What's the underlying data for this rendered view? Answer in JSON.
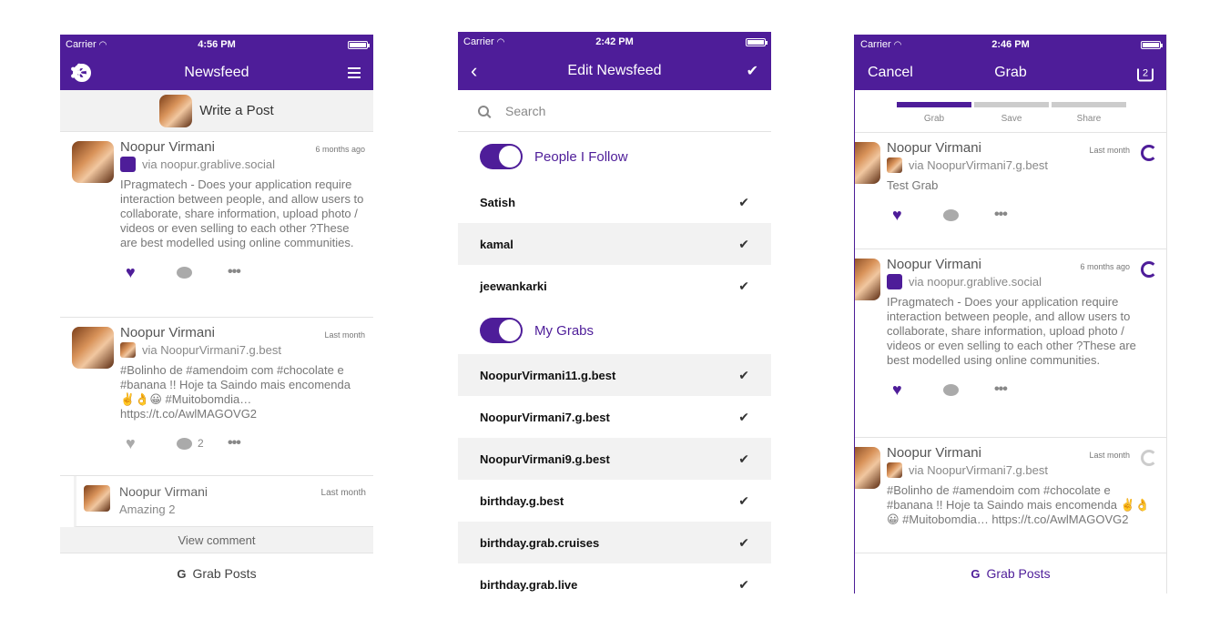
{
  "colors": {
    "accent": "#4e1d99",
    "muted": "#888888",
    "row_alt": "#f2f2f2"
  },
  "status": {
    "carrier": "Carrier"
  },
  "screen1": {
    "time": "4:56 PM",
    "title": "Newsfeed",
    "write_post": "Write a Post",
    "posts": [
      {
        "name": "Noopur Virmani",
        "time": "6 months ago",
        "via": "via noopur.grablive.social",
        "body": "IPragmatech - Does your application require interaction between people, and allow users to collaborate, share information, upload photo / videos or even selling to each other ?These are best modelled using online communities."
      },
      {
        "name": "Noopur Virmani",
        "time": "Last month",
        "via": "via NoopurVirmani7.g.best",
        "body": "#Bolinho de #amendoim com #chocolate e #banana !! Hoje ta Saindo mais encomenda ✌️👌😀 #Muitobomdia… https://t.co/AwlMAGOVG2",
        "comment_count": "2"
      }
    ],
    "comment": {
      "name": "Noopur Virmani",
      "time": "Last month",
      "text": "Amazing 2"
    },
    "view_comment": "View comment",
    "grab_posts": "Grab Posts"
  },
  "screen2": {
    "time": "2:42 PM",
    "title": "Edit Newsfeed",
    "search_placeholder": "Search",
    "section1": "People I Follow",
    "follow": [
      "Satish",
      "kamal",
      "jeewankarki"
    ],
    "section2": "My Grabs",
    "grabs": [
      "NoopurVirmani11.g.best",
      "NoopurVirmani7.g.best",
      "NoopurVirmani9.g.best",
      "birthday.g.best",
      "birthday.grab.cruises",
      "birthday.grab.live"
    ]
  },
  "screen3": {
    "time": "2:46 PM",
    "cancel": "Cancel",
    "title": "Grab",
    "upload_badge": "2",
    "steps": [
      "Grab",
      "Save",
      "Share"
    ],
    "posts": [
      {
        "name": "Noopur Virmani",
        "time": "Last month",
        "via": "via NoopurVirmani7.g.best",
        "body": "Test Grab"
      },
      {
        "name": "Noopur Virmani",
        "time": "6 months ago",
        "via": "via noopur.grablive.social",
        "body": "IPragmatech - Does your application require interaction between people, and allow users to collaborate, share information, upload photo / videos or even selling to each other ?These are best modelled using online communities."
      },
      {
        "name": "Noopur Virmani",
        "time": "Last month",
        "via": "via NoopurVirmani7.g.best",
        "body": "#Bolinho de #amendoim com #chocolate e #banana !! Hoje ta Saindo mais encomenda ✌️👌😀 #Muitobomdia… https://t.co/AwlMAGOVG2"
      }
    ],
    "grab_posts": "Grab Posts"
  }
}
